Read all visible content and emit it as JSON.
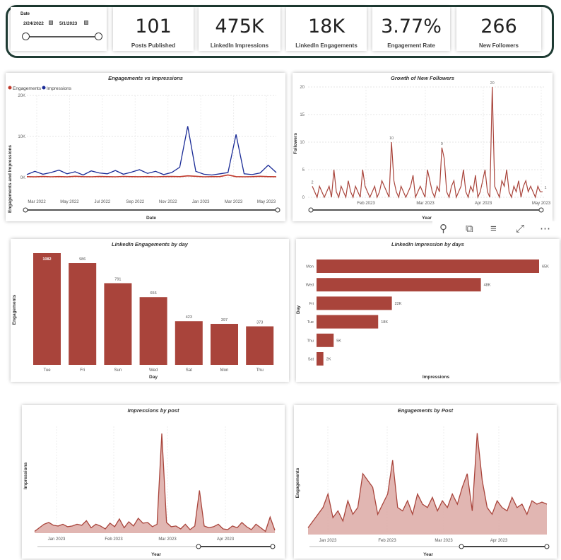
{
  "filters": {
    "date_slicer": {
      "title": "Date",
      "start": "2/24/2022",
      "end": "5/1/2023",
      "calendar_icon": "calendar-icon"
    }
  },
  "kpis": [
    {
      "value": "101",
      "label": "Posts Published"
    },
    {
      "value": "475K",
      "label": "LinkedIn Impressions"
    },
    {
      "value": "18K",
      "label": "LinkedIn Engagements"
    },
    {
      "value": "3.77%",
      "label": "Engagement Rate"
    },
    {
      "value": "266",
      "label": "New Followers"
    }
  ],
  "visual_header": {
    "icons": [
      "pin-icon",
      "copy-icon",
      "filter-icon",
      "focus-mode-icon",
      "more-options-icon"
    ]
  },
  "colors": {
    "primary": "#a9443b",
    "impressions": "#1a2b96",
    "engagements": "#c0392b",
    "area_fill": "#dca9a4",
    "kpi_border": "#1e3b33"
  },
  "chart_data": [
    {
      "type": "line",
      "title": "Engagements vs Impressions",
      "xlabel": "Date",
      "ylabel": "Engagements and Impressions",
      "x_ticks": [
        "Mar 2022",
        "May 2022",
        "Jul 2022",
        "Sep 2022",
        "Nov 2022",
        "Jan 2023",
        "Mar 2023",
        "May 2023"
      ],
      "y_ticks": [
        "0K",
        "10K",
        "20K"
      ],
      "ylim": [
        0,
        20000
      ],
      "legend": "top-left",
      "series": [
        {
          "name": "Engagements",
          "values": [
            200,
            150,
            250,
            180,
            220,
            160,
            300,
            200,
            180,
            250,
            210,
            170,
            260,
            200,
            190,
            230,
            180,
            220,
            250,
            200,
            400,
            300,
            180,
            200,
            220,
            600,
            200,
            180,
            210,
            300,
            200,
            190
          ]
        },
        {
          "name": "Impressions",
          "values": [
            700,
            1500,
            800,
            1200,
            1800,
            900,
            1400,
            600,
            1600,
            1100,
            900,
            1700,
            800,
            1300,
            1900,
            1000,
            1500,
            700,
            1200,
            2500,
            12500,
            1500,
            800,
            600,
            900,
            1200,
            10500,
            900,
            700,
            1100,
            3000,
            1200
          ]
        }
      ]
    },
    {
      "type": "line",
      "title": "Growth of New Followers",
      "xlabel": "Year",
      "ylabel": "Followers",
      "x_ticks": [
        "Feb 2023",
        "Mar 2023",
        "Apr 2023",
        "May 2023"
      ],
      "y_ticks": [
        "0",
        "5",
        "10",
        "15",
        "20"
      ],
      "ylim": [
        0,
        20
      ],
      "data_labels": [
        "2",
        "10",
        "9",
        "20",
        "1"
      ],
      "values": [
        2,
        1,
        0,
        2,
        1,
        0,
        1,
        2,
        0,
        5,
        1,
        0,
        2,
        1,
        0,
        3,
        1,
        0,
        2,
        1,
        0,
        5,
        2,
        1,
        0,
        1,
        2,
        0,
        1,
        3,
        2,
        1,
        0,
        10,
        3,
        1,
        0,
        2,
        1,
        0,
        1,
        2,
        4,
        0,
        1,
        2,
        1,
        0,
        5,
        3,
        1,
        0,
        2,
        1,
        9,
        7,
        1,
        0,
        2,
        3,
        0,
        1,
        2,
        5,
        1,
        0,
        2,
        1,
        4,
        0,
        1,
        3,
        5,
        1,
        0,
        20,
        2,
        1,
        0,
        3,
        2,
        5,
        1,
        0,
        2,
        1,
        3,
        0,
        2,
        3,
        1,
        2,
        1,
        0,
        2,
        1,
        1
      ]
    },
    {
      "type": "bar",
      "title": "LinkedIn Engagements by day",
      "xlabel": "Day",
      "ylabel": "Engagements",
      "categories": [
        "Tue",
        "Fri",
        "Sun",
        "Wed",
        "Sat",
        "Mon",
        "Thu"
      ],
      "values": [
        1082,
        986,
        791,
        656,
        423,
        397,
        373
      ],
      "labels": [
        "1082",
        "986",
        "791",
        "656",
        "423",
        "397",
        "373"
      ]
    },
    {
      "type": "bar",
      "orientation": "horizontal",
      "title": "LinkedIn Impression by days",
      "xlabel": "Impressions",
      "ylabel": "Day",
      "categories": [
        "Mon",
        "Wed",
        "Fri",
        "Tue",
        "Thu",
        "Sat"
      ],
      "values": [
        65000,
        48000,
        22000,
        18000,
        5000,
        2000
      ],
      "labels": [
        "65K",
        "48K",
        "22K",
        "18K",
        "5K",
        "2K"
      ]
    },
    {
      "type": "area",
      "title": "Impressions by post",
      "xlabel": "Year",
      "ylabel": "Impressions",
      "x_ticks": [
        "Jan 2023",
        "Feb 2023",
        "Mar 2023",
        "Apr 2023"
      ],
      "ylim": [
        0,
        30000
      ],
      "values": [
        500,
        1500,
        2500,
        3000,
        2200,
        2000,
        2500,
        1800,
        2000,
        2500,
        2200,
        3500,
        1500,
        2500,
        2000,
        1200,
        2800,
        1800,
        4000,
        1500,
        3200,
        2000,
        4200,
        2800,
        3000,
        1800,
        2500,
        28000,
        3000,
        1800,
        2000,
        1200,
        2500,
        1000,
        2000,
        12000,
        2000,
        1500,
        1800,
        2500,
        1200,
        1000,
        2000,
        1500,
        3000,
        1800,
        1000,
        2500,
        1500,
        500,
        4500,
        800
      ]
    },
    {
      "type": "area",
      "title": "Engagements by Post",
      "xlabel": "Year",
      "ylabel": "Engagements",
      "x_ticks": [
        "Jan 2023",
        "Feb 2023",
        "Mar 2023",
        "Apr 2023"
      ],
      "ylim": [
        0,
        160
      ],
      "values": [
        10,
        20,
        30,
        40,
        60,
        25,
        35,
        20,
        50,
        30,
        40,
        90,
        80,
        70,
        30,
        45,
        60,
        110,
        40,
        35,
        50,
        30,
        60,
        45,
        40,
        55,
        35,
        50,
        40,
        60,
        45,
        70,
        90,
        35,
        150,
        80,
        40,
        30,
        50,
        40,
        35,
        55,
        40,
        45,
        30,
        50,
        45,
        48,
        45
      ]
    }
  ]
}
